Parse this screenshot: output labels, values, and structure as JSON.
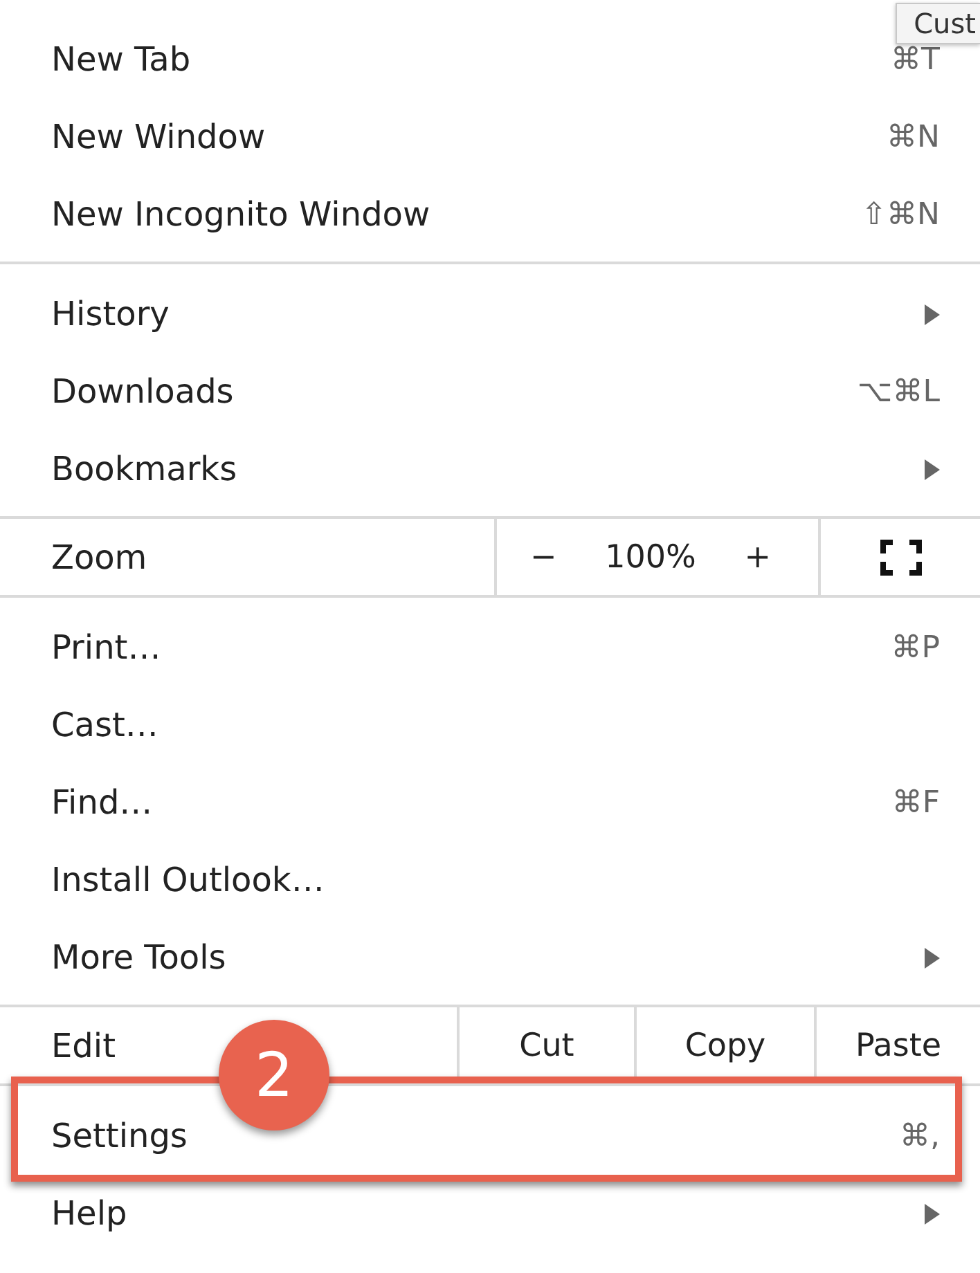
{
  "tooltip": {
    "text": "Cust"
  },
  "menu": {
    "sections": [
      {
        "kind": "list",
        "items": [
          {
            "label": "New Tab",
            "shortcut": "⌘T",
            "submenu": false,
            "highlighted": false
          },
          {
            "label": "New Window",
            "shortcut": "⌘N",
            "submenu": false,
            "highlighted": false
          },
          {
            "label": "New Incognito Window",
            "shortcut": "⇧⌘N",
            "submenu": false,
            "highlighted": false
          }
        ]
      },
      {
        "kind": "list",
        "items": [
          {
            "label": "History",
            "submenu": true,
            "highlighted": false
          },
          {
            "label": "Downloads",
            "shortcut": "⌥⌘L",
            "submenu": false,
            "highlighted": false
          },
          {
            "label": "Bookmarks",
            "submenu": true,
            "highlighted": false
          }
        ]
      },
      {
        "kind": "zoom",
        "label": "Zoom",
        "minus": "−",
        "value": "100%",
        "plus": "+"
      },
      {
        "kind": "list",
        "items": [
          {
            "label": "Print…",
            "shortcut": "⌘P",
            "submenu": false,
            "highlighted": false
          },
          {
            "label": "Cast…",
            "submenu": false,
            "highlighted": false
          },
          {
            "label": "Find…",
            "shortcut": "⌘F",
            "submenu": false,
            "highlighted": false
          },
          {
            "label": "Install Outlook…",
            "submenu": false,
            "highlighted": false
          },
          {
            "label": "More Tools",
            "submenu": true,
            "highlighted": false
          }
        ]
      },
      {
        "kind": "edit",
        "label": "Edit",
        "actions": [
          "Cut",
          "Copy",
          "Paste"
        ]
      },
      {
        "kind": "list",
        "items": [
          {
            "label": "Settings",
            "shortcut": "⌘,",
            "submenu": false,
            "highlighted": true,
            "step": "2"
          },
          {
            "label": "Help",
            "submenu": true,
            "highlighted": false
          }
        ]
      }
    ]
  }
}
